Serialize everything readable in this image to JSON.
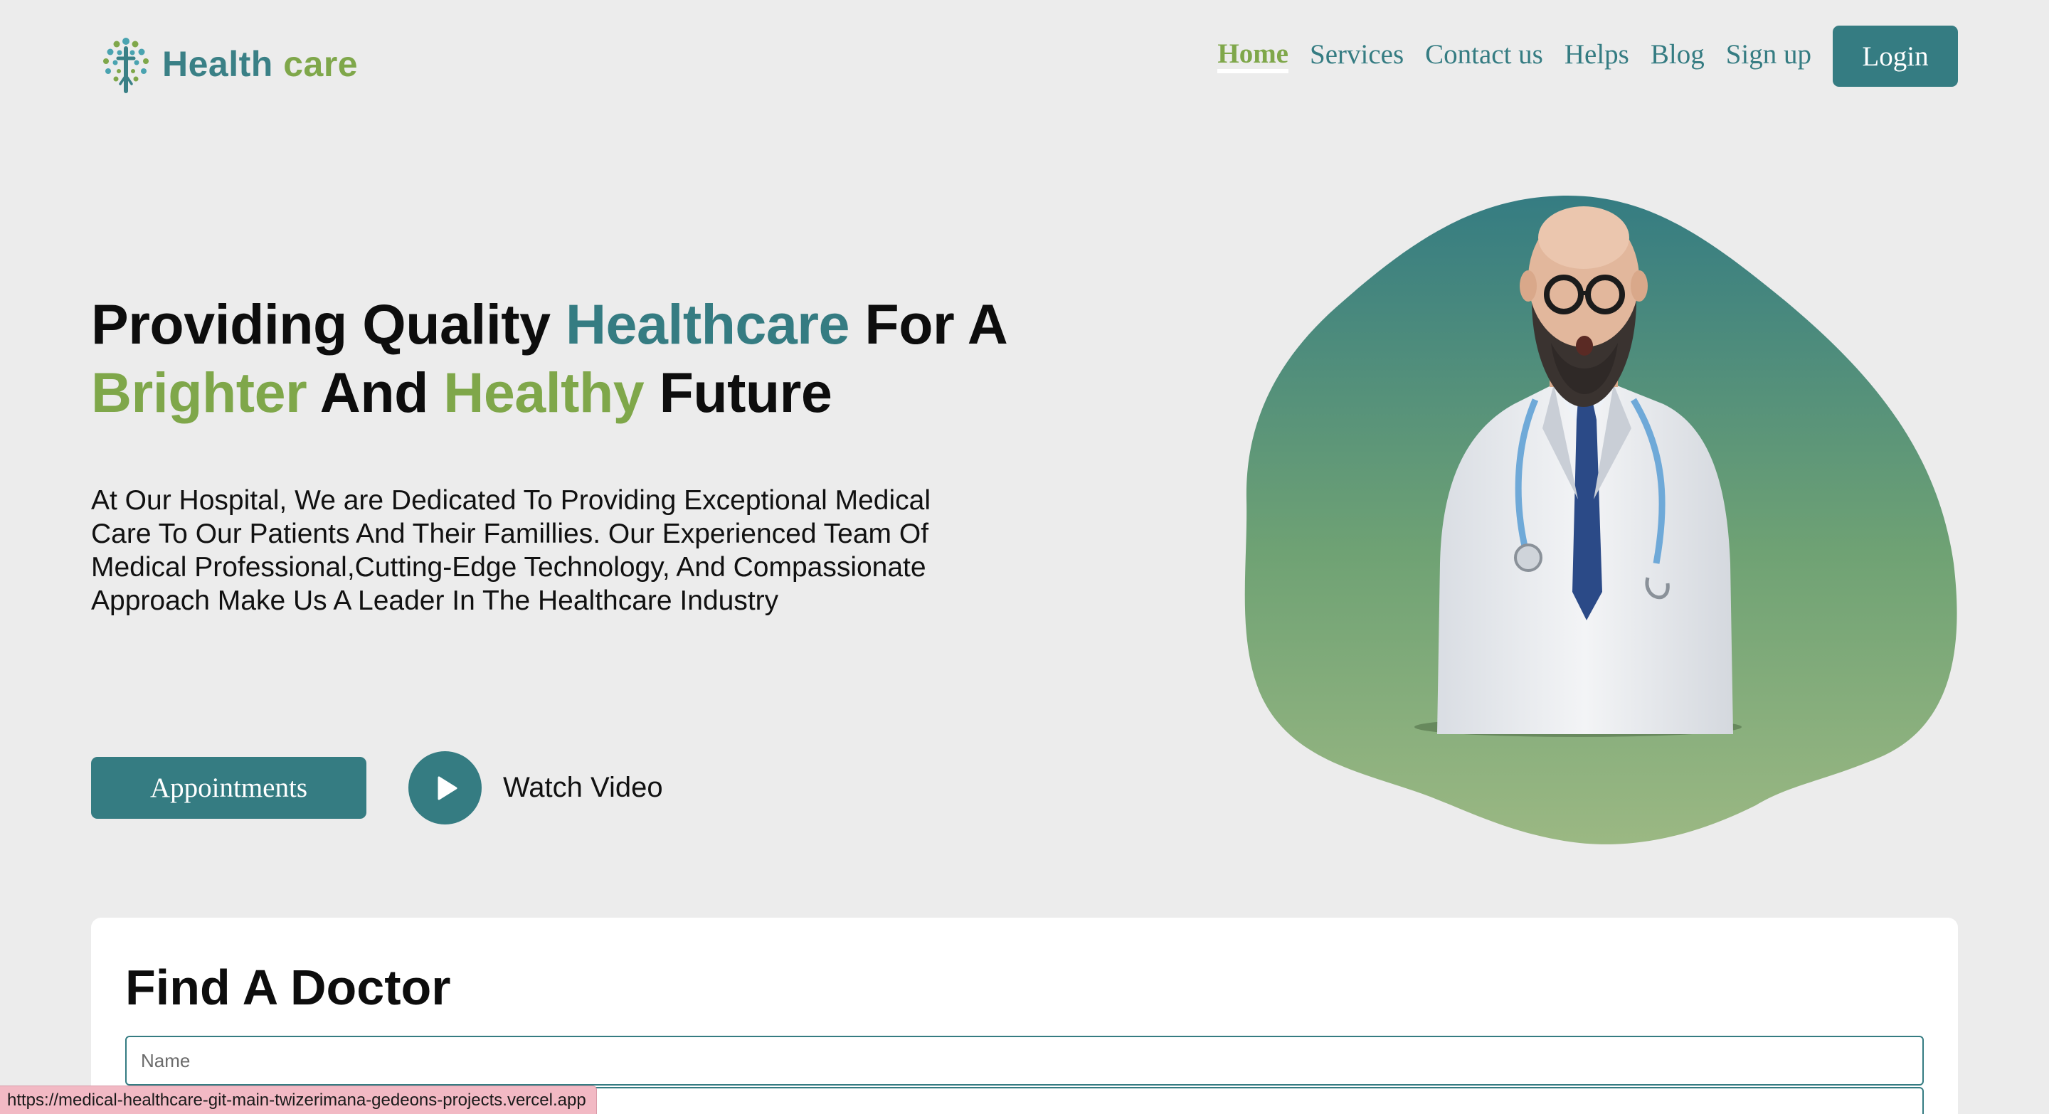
{
  "brand": {
    "name_part1": "Health",
    "name_part2": "care"
  },
  "nav": {
    "items": [
      "Home",
      "Services",
      "Contact us",
      "Helps",
      "Blog",
      "Sign up"
    ],
    "login_label": "Login"
  },
  "hero": {
    "title": {
      "w1": "Providing Quality ",
      "w2": "Healthcare",
      "w3": " For A",
      "w4": "Brighter",
      "w5": " And ",
      "w6": "Healthy",
      "w7": " Future"
    },
    "description": "At Our Hospital, We are Dedicated To Providing Exceptional Medical Care To Our Patients And Their Famillies. Our Experienced Team Of Medical Professional,Cutting-Edge Technology, And Compassionate Approach Make Us A Leader In The Healthcare Industry",
    "appointments_label": "Appointments",
    "watch_video_label": "Watch Video"
  },
  "find_doctor": {
    "title": "Find A Doctor",
    "name_placeholder": "Name"
  },
  "status_bar": {
    "url": "https://medical-healthcare-git-main-twizerimana-gedeons-projects.vercel.app"
  },
  "colors": {
    "teal": "#357c82",
    "green": "#7fa74a",
    "background": "#ececec"
  }
}
